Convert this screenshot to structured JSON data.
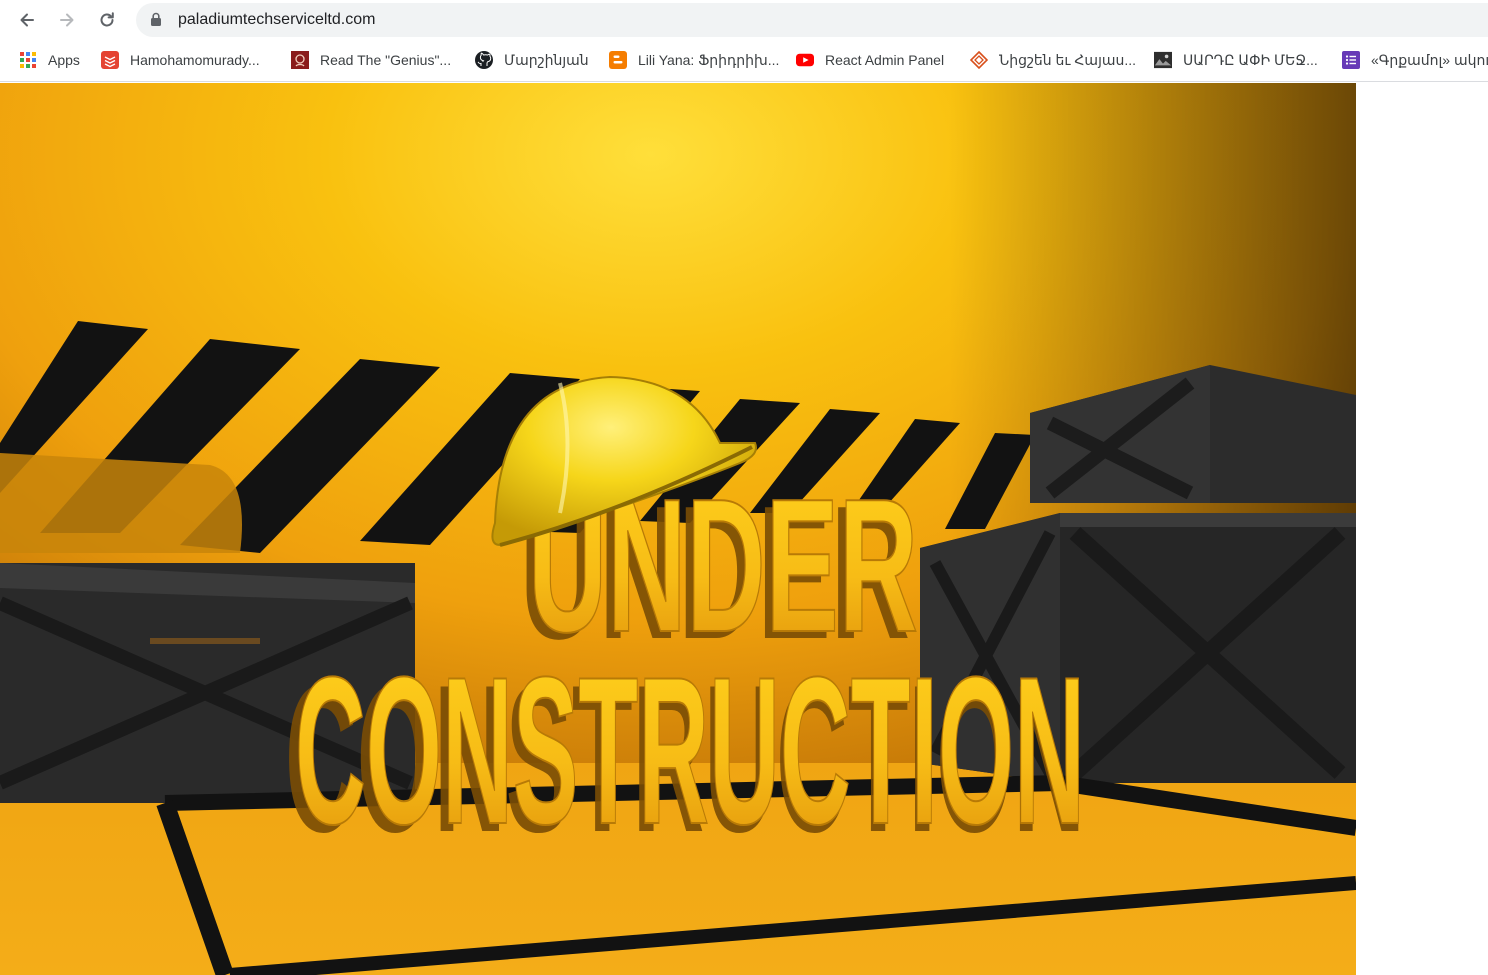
{
  "browser": {
    "url": "paladiumtechserviceltd.com",
    "bookmarks": [
      {
        "label": "Apps",
        "icon": "apps-grid-icon"
      },
      {
        "label": "Hamohamomurady...",
        "icon": "todoist-icon"
      },
      {
        "label": "Read The \"Genius\"...",
        "icon": "book-icon"
      },
      {
        "label": "Մարշինյան",
        "icon": "github-icon"
      },
      {
        "label": "Lili Yana: Ֆրիդրիխ...",
        "icon": "blogger-icon"
      },
      {
        "label": "React Admin Panel",
        "icon": "youtube-icon"
      },
      {
        "label": "Նիցշեն եւ Հայաս...",
        "icon": "diamond-icon"
      },
      {
        "label": "ՍԱՐԴԸ ԱՓԻ ՄԵՋ...",
        "icon": "photo-icon"
      },
      {
        "label": "«Գրքամոլ» ակու",
        "icon": "forms-icon"
      }
    ]
  },
  "hero": {
    "line1": "UNDER",
    "line2": "CONSTRUCTION"
  },
  "colors": {
    "background_yellow": "#f4a912",
    "letters_yellow": "#f7c31a",
    "crates": "#2b2b2b",
    "stripes": "#121212",
    "helmet": "#f3d21a"
  }
}
